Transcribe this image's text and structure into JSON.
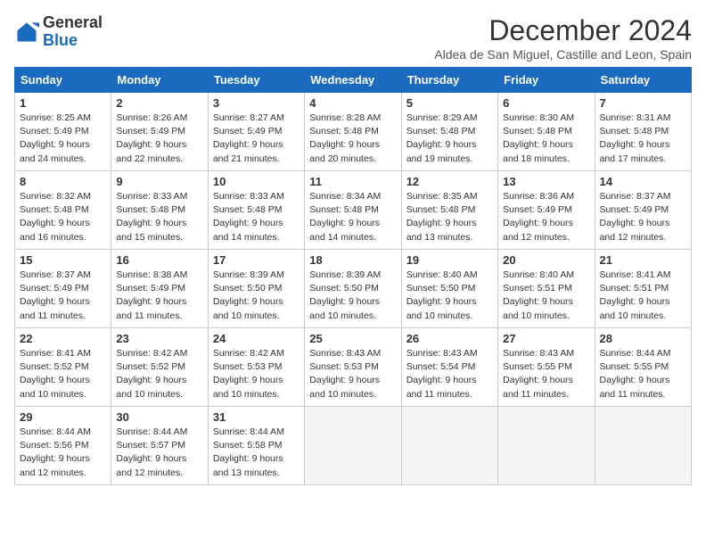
{
  "header": {
    "logo_general": "General",
    "logo_blue": "Blue",
    "month_title": "December 2024",
    "location": "Aldea de San Miguel, Castille and Leon, Spain"
  },
  "columns": [
    "Sunday",
    "Monday",
    "Tuesday",
    "Wednesday",
    "Thursday",
    "Friday",
    "Saturday"
  ],
  "weeks": [
    [
      {
        "day": "1",
        "sunrise": "Sunrise: 8:25 AM",
        "sunset": "Sunset: 5:49 PM",
        "daylight": "Daylight: 9 hours and 24 minutes."
      },
      {
        "day": "2",
        "sunrise": "Sunrise: 8:26 AM",
        "sunset": "Sunset: 5:49 PM",
        "daylight": "Daylight: 9 hours and 22 minutes."
      },
      {
        "day": "3",
        "sunrise": "Sunrise: 8:27 AM",
        "sunset": "Sunset: 5:49 PM",
        "daylight": "Daylight: 9 hours and 21 minutes."
      },
      {
        "day": "4",
        "sunrise": "Sunrise: 8:28 AM",
        "sunset": "Sunset: 5:48 PM",
        "daylight": "Daylight: 9 hours and 20 minutes."
      },
      {
        "day": "5",
        "sunrise": "Sunrise: 8:29 AM",
        "sunset": "Sunset: 5:48 PM",
        "daylight": "Daylight: 9 hours and 19 minutes."
      },
      {
        "day": "6",
        "sunrise": "Sunrise: 8:30 AM",
        "sunset": "Sunset: 5:48 PM",
        "daylight": "Daylight: 9 hours and 18 minutes."
      },
      {
        "day": "7",
        "sunrise": "Sunrise: 8:31 AM",
        "sunset": "Sunset: 5:48 PM",
        "daylight": "Daylight: 9 hours and 17 minutes."
      }
    ],
    [
      {
        "day": "8",
        "sunrise": "Sunrise: 8:32 AM",
        "sunset": "Sunset: 5:48 PM",
        "daylight": "Daylight: 9 hours and 16 minutes."
      },
      {
        "day": "9",
        "sunrise": "Sunrise: 8:33 AM",
        "sunset": "Sunset: 5:48 PM",
        "daylight": "Daylight: 9 hours and 15 minutes."
      },
      {
        "day": "10",
        "sunrise": "Sunrise: 8:33 AM",
        "sunset": "Sunset: 5:48 PM",
        "daylight": "Daylight: 9 hours and 14 minutes."
      },
      {
        "day": "11",
        "sunrise": "Sunrise: 8:34 AM",
        "sunset": "Sunset: 5:48 PM",
        "daylight": "Daylight: 9 hours and 14 minutes."
      },
      {
        "day": "12",
        "sunrise": "Sunrise: 8:35 AM",
        "sunset": "Sunset: 5:48 PM",
        "daylight": "Daylight: 9 hours and 13 minutes."
      },
      {
        "day": "13",
        "sunrise": "Sunrise: 8:36 AM",
        "sunset": "Sunset: 5:49 PM",
        "daylight": "Daylight: 9 hours and 12 minutes."
      },
      {
        "day": "14",
        "sunrise": "Sunrise: 8:37 AM",
        "sunset": "Sunset: 5:49 PM",
        "daylight": "Daylight: 9 hours and 12 minutes."
      }
    ],
    [
      {
        "day": "15",
        "sunrise": "Sunrise: 8:37 AM",
        "sunset": "Sunset: 5:49 PM",
        "daylight": "Daylight: 9 hours and 11 minutes."
      },
      {
        "day": "16",
        "sunrise": "Sunrise: 8:38 AM",
        "sunset": "Sunset: 5:49 PM",
        "daylight": "Daylight: 9 hours and 11 minutes."
      },
      {
        "day": "17",
        "sunrise": "Sunrise: 8:39 AM",
        "sunset": "Sunset: 5:50 PM",
        "daylight": "Daylight: 9 hours and 10 minutes."
      },
      {
        "day": "18",
        "sunrise": "Sunrise: 8:39 AM",
        "sunset": "Sunset: 5:50 PM",
        "daylight": "Daylight: 9 hours and 10 minutes."
      },
      {
        "day": "19",
        "sunrise": "Sunrise: 8:40 AM",
        "sunset": "Sunset: 5:50 PM",
        "daylight": "Daylight: 9 hours and 10 minutes."
      },
      {
        "day": "20",
        "sunrise": "Sunrise: 8:40 AM",
        "sunset": "Sunset: 5:51 PM",
        "daylight": "Daylight: 9 hours and 10 minutes."
      },
      {
        "day": "21",
        "sunrise": "Sunrise: 8:41 AM",
        "sunset": "Sunset: 5:51 PM",
        "daylight": "Daylight: 9 hours and 10 minutes."
      }
    ],
    [
      {
        "day": "22",
        "sunrise": "Sunrise: 8:41 AM",
        "sunset": "Sunset: 5:52 PM",
        "daylight": "Daylight: 9 hours and 10 minutes."
      },
      {
        "day": "23",
        "sunrise": "Sunrise: 8:42 AM",
        "sunset": "Sunset: 5:52 PM",
        "daylight": "Daylight: 9 hours and 10 minutes."
      },
      {
        "day": "24",
        "sunrise": "Sunrise: 8:42 AM",
        "sunset": "Sunset: 5:53 PM",
        "daylight": "Daylight: 9 hours and 10 minutes."
      },
      {
        "day": "25",
        "sunrise": "Sunrise: 8:43 AM",
        "sunset": "Sunset: 5:53 PM",
        "daylight": "Daylight: 9 hours and 10 minutes."
      },
      {
        "day": "26",
        "sunrise": "Sunrise: 8:43 AM",
        "sunset": "Sunset: 5:54 PM",
        "daylight": "Daylight: 9 hours and 11 minutes."
      },
      {
        "day": "27",
        "sunrise": "Sunrise: 8:43 AM",
        "sunset": "Sunset: 5:55 PM",
        "daylight": "Daylight: 9 hours and 11 minutes."
      },
      {
        "day": "28",
        "sunrise": "Sunrise: 8:44 AM",
        "sunset": "Sunset: 5:55 PM",
        "daylight": "Daylight: 9 hours and 11 minutes."
      }
    ],
    [
      {
        "day": "29",
        "sunrise": "Sunrise: 8:44 AM",
        "sunset": "Sunset: 5:56 PM",
        "daylight": "Daylight: 9 hours and 12 minutes."
      },
      {
        "day": "30",
        "sunrise": "Sunrise: 8:44 AM",
        "sunset": "Sunset: 5:57 PM",
        "daylight": "Daylight: 9 hours and 12 minutes."
      },
      {
        "day": "31",
        "sunrise": "Sunrise: 8:44 AM",
        "sunset": "Sunset: 5:58 PM",
        "daylight": "Daylight: 9 hours and 13 minutes."
      },
      null,
      null,
      null,
      null
    ]
  ]
}
